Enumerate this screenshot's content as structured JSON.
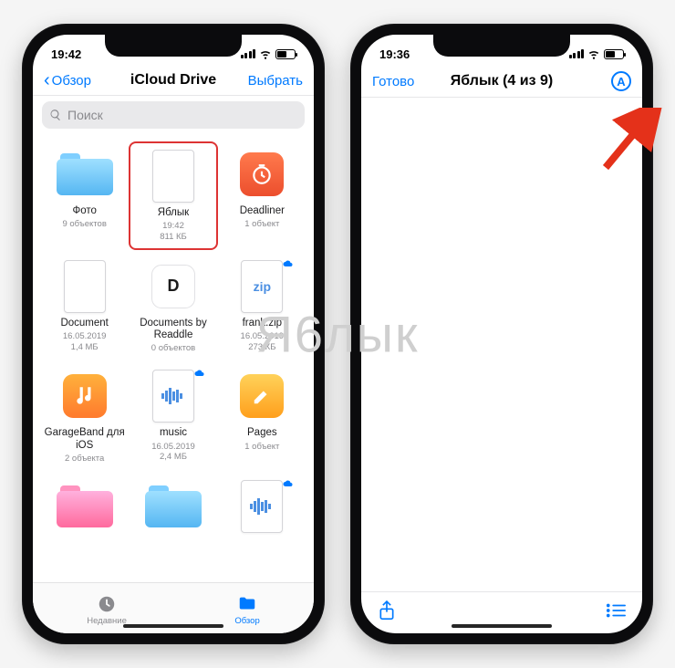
{
  "watermark": "Я6лык",
  "left": {
    "status_time": "19:42",
    "nav": {
      "back": "Обзор",
      "title": "iCloud Drive",
      "select": "Выбрать"
    },
    "search_placeholder": "Поиск",
    "items": [
      {
        "name": "Фото",
        "meta": "9 объектов",
        "kind": "folder",
        "cloud": false
      },
      {
        "name": "Яблык",
        "meta": "19:42\n811 КБ",
        "kind": "sheet",
        "cloud": false,
        "highlight": true
      },
      {
        "name": "Deadliner",
        "meta": "1 объект",
        "kind": "app-deadliner",
        "cloud": false
      },
      {
        "name": "Document",
        "meta": "16.05.2019\n1,4 МБ",
        "kind": "sheet",
        "cloud": false
      },
      {
        "name": "Documents by Readdle",
        "meta": "0 объектов",
        "kind": "app-readdle",
        "cloud": false
      },
      {
        "name": "frank.zip",
        "meta": "16.05.2019\n273 КБ",
        "kind": "sheet-zip",
        "cloud": true
      },
      {
        "name": "GarageBand для iOS",
        "meta": "2 объекта",
        "kind": "app-gb",
        "cloud": false
      },
      {
        "name": "music",
        "meta": "16.05.2019\n2,4 МБ",
        "kind": "sheet-audio",
        "cloud": true
      },
      {
        "name": "Pages",
        "meta": "1 объект",
        "kind": "app-pages",
        "cloud": false
      },
      {
        "name": "",
        "meta": "",
        "kind": "folder-red",
        "cloud": false
      },
      {
        "name": "",
        "meta": "",
        "kind": "folder",
        "cloud": false
      },
      {
        "name": "",
        "meta": "",
        "kind": "sheet-audio",
        "cloud": true
      }
    ],
    "tabs": {
      "recent": "Недавние",
      "browse": "Обзор"
    }
  },
  "right": {
    "status_time": "19:36",
    "nav": {
      "done": "Готово",
      "title": "Яблык (4 из 9)",
      "annot_glyph": "A"
    }
  }
}
